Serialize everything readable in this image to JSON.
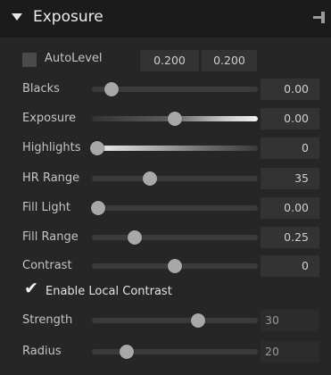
{
  "header": {
    "title": "Exposure"
  },
  "autolevel": {
    "label": "AutoLevel",
    "checked": false,
    "value1": "0.200",
    "value2": "0.200"
  },
  "sliders": [
    {
      "label": "Blacks",
      "value": "0.00",
      "level": 0.12
    },
    {
      "label": "Exposure",
      "value": "0.00",
      "level": 0.5
    },
    {
      "label": "Highlights",
      "value": "0",
      "level": 0.03
    },
    {
      "label": "HR Range",
      "value": "35",
      "level": 0.35
    },
    {
      "label": "Fill Light",
      "value": "0.00",
      "level": 0.04
    },
    {
      "label": "Fill Range",
      "value": "0.25",
      "level": 0.26
    },
    {
      "label": "Contrast",
      "value": "0",
      "level": 0.5
    }
  ],
  "local_contrast": {
    "label": "Enable Local Contrast",
    "checked": true
  },
  "local_sliders": [
    {
      "label": "Strength",
      "value": "30",
      "level": 0.64
    },
    {
      "label": "Radius",
      "value": "20",
      "level": 0.21
    }
  ]
}
